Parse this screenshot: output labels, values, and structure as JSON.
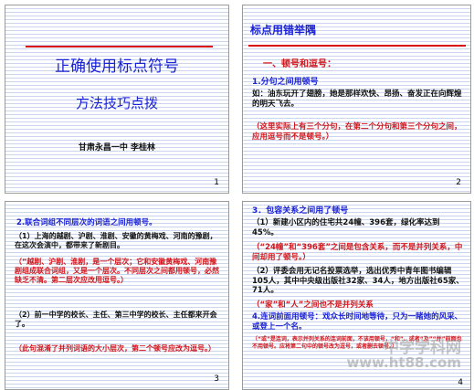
{
  "slide1": {
    "title": "正确使用标点符号",
    "subtitle": "方法技巧点拨",
    "author": "甘肃永昌一中    李桂林",
    "number": "1"
  },
  "slide2": {
    "heading": "标点用错举隅",
    "section": "一、顿号和逗号：",
    "item": "1.分句之间用顿号",
    "example": "如：油东玩开了翅膀，她是那样欢快、昂扬、奋发正在向辉煌的明天飞去。",
    "note": "（这里实际上有三个分句，在第二个分句和第三个分句之间，应用逗号而不是顿号。）",
    "number": "2"
  },
  "slide3": {
    "item": "2.联合词组不同层次的词语之间用顿号。",
    "example1": "（1）上海的越剧、沪剧、淮剧、安徽的黄梅戏、河南的豫剧，在这次会演中，都带来了新剧目。",
    "note1": "（“越剧、沪剧、淮剧，是一个层次；它和安徽黄梅戏、河南豫剧组成联合词组，又是一个层次。不同层次之间都用顿号，必然缺乏不清。第二层次应改用逗号。）",
    "example2": "（2）前一中学的校长、主任、第三中学的校长、主任都来开会了。",
    "note2": "（此句混淆了并列词语的大小层次，第二个顿号应改为逗号。）",
    "number": "3"
  },
  "slide4": {
    "item1": "3．包容关系之间用了顿号",
    "example1": "（1）新建小区内的住宅共24幢、396套，绿化率达到45%。",
    "note1": "（“24幢”和“396套”之间是包含关系，而不是并列关系，中间却用了顿号。）",
    "example2": "（2）评委会用无记名投票选举，选出优秀中青年图书编辑105人，其中中央级出版社32家、34人，地方出版社65家、71人。",
    "note2": "（“家”和“人”之间也不是并列关系",
    "item2": "4.连词前面用顿号：戏众长时间地等待，只为一睹她的风采、或登上一个名。",
    "note3": "（“或”是连词，表示并列关系的连词前面，不该用顿号，“和”、或者“及”“并”前面也不用顿号。应将第二句中的顿号改为逗号，或者删去顿号。）",
    "number": "4"
  },
  "watermark": {
    "top": "中学学科网",
    "bottom": "www.ht88.com"
  },
  "colors": {
    "blue_text": "#1a22d6",
    "red_text": "#d2161c",
    "rule_red": "#d80b14",
    "slide_lines": "#c9d6ee"
  }
}
